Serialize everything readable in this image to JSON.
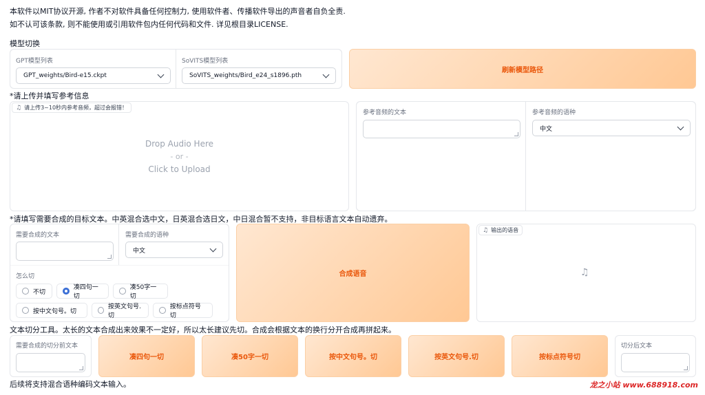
{
  "notice": {
    "line1": "本软件以MIT协议开源, 作者不对软件具备任何控制力, 使用软件者、传播软件导出的声音者自负全责.",
    "line2": "如不认可该条款, 则不能使用或引用软件包内任何代码和文件. 详见根目录LICENSE."
  },
  "model_switch": {
    "title": "模型切换",
    "gpt_label": "GPT模型列表",
    "gpt_value": "GPT_weights/Bird-e15.ckpt",
    "sovits_label": "SoVITS模型列表",
    "sovits_value": "SoVITS_weights/Bird_e24_s1896.pth",
    "refresh_button": "刷新模型路径"
  },
  "reference": {
    "title": "*请上传并填写参考信息",
    "audio_tag": "请上传3~10秒内参考音频，超过会报错！",
    "drop_text": "Drop Audio Here",
    "or_text": "- or -",
    "click_text": "Click to Upload",
    "ref_text_label": "参考音频的文本",
    "ref_lang_label": "参考音频的语种",
    "ref_lang_value": "中文"
  },
  "synthesis": {
    "title": "*请填写需要合成的目标文本。中英混合选中文，日英混合选日文，中日混合暂不支持，非目标语言文本自动遗弃。",
    "text_label": "需要合成的文本",
    "lang_label": "需要合成的语种",
    "lang_value": "中文",
    "cut_label": "怎么切",
    "cut_options": [
      "不切",
      "凑四句一切",
      "凑50字一切",
      "按中文句号。切",
      "按英文句号.切",
      "按标点符号切"
    ],
    "synth_button": "合成语音",
    "output_tag": "输出的语音"
  },
  "splitter": {
    "title": "文本切分工具。太长的文本合成出来效果不一定好，所以太长建议先切。合成会根据文本的换行分开合成再拼起来。",
    "input_label": "需要合成的切分前文本",
    "buttons": [
      "凑四句一切",
      "凑50字一切",
      "按中文句号。切",
      "按英文句号.切",
      "按标点符号切"
    ],
    "output_label": "切分后文本"
  },
  "footer": {
    "text": "后续将支持混合语种编码文本输入。",
    "watermark": "龙之小站 www.688918.com"
  },
  "colors": {
    "accent": "#ea580c",
    "radio_selected": "#3b6fd6"
  }
}
